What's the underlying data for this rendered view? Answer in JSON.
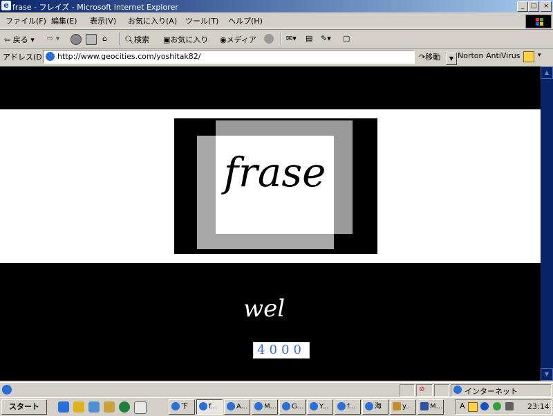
{
  "window": {
    "title": "frase - フレイズ - Microsoft Internet Explorer"
  },
  "menu": [
    "ファイル(F)",
    "編集(E)",
    "表示(V)",
    "お気に入り(A)",
    "ツール(T)",
    "ヘルプ(H)"
  ],
  "toolbar": {
    "back": "戻る",
    "search": "検索",
    "favorites": "お気に入り",
    "media": "メディア"
  },
  "address": {
    "label": "アドレス(D)",
    "url": "http://www.geocities.com/yoshitak82/",
    "go": "移動",
    "norton": "Norton AntiVirus"
  },
  "page": {
    "logo_text": "frase",
    "welcome_text": "wel",
    "counter": "4000"
  },
  "status": {
    "zone": "インターネット"
  },
  "taskbar": {
    "start": "スタート",
    "tasks": [
      "下",
      "f...",
      "A...",
      "M...",
      "G...",
      "Y...",
      "f...",
      "海",
      "y...",
      "M..."
    ],
    "clock": "23:14"
  },
  "colors": {
    "titlebar": "#0a246a",
    "page_bg": "#000000",
    "band": "#ffffff",
    "counter_digits": "#3a6dc8"
  },
  "icons": [
    "ie-icon",
    "back-arrow-icon",
    "forward-arrow-icon",
    "stop-icon",
    "refresh-icon",
    "home-icon",
    "search-icon",
    "favorites-icon",
    "media-icon",
    "history-icon",
    "mail-icon",
    "print-icon",
    "edit-icon",
    "go-arrow-icon",
    "norton-icon",
    "windows-logo-icon"
  ]
}
